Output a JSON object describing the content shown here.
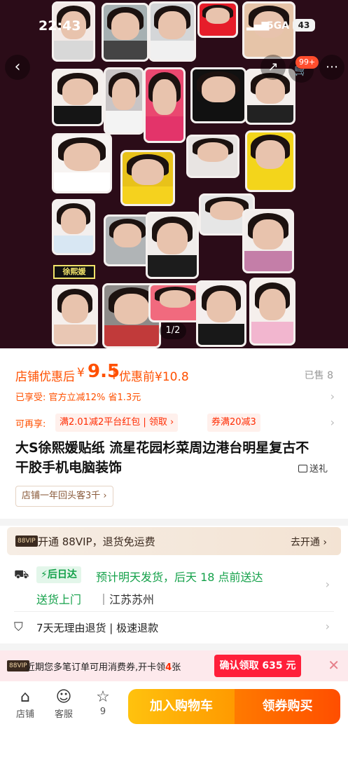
{
  "status_bar": {
    "time": "22:43",
    "network": "5GA",
    "battery": "43"
  },
  "header": {
    "back_icon": "back-arrow-icon",
    "share_icon": "share-icon",
    "cart_icon": "cart-icon",
    "cart_badge": "99+",
    "more_icon": "more-icon"
  },
  "gallery": {
    "pager": "1/2",
    "name_sticker": "徐熙媛"
  },
  "price": {
    "label": "店铺优惠后",
    "currency": "¥",
    "value": "9.5",
    "separator": "|",
    "before_label": "优惠前¥10.8",
    "sold": "已售 8"
  },
  "enjoyed": {
    "text": "已享受: 官方立减12% 省1.3元"
  },
  "more_offers": {
    "label": "可再享:",
    "coupon_platform": "满2.01减2平台红包 | 领取 ›",
    "coupon_store": "券满20减3"
  },
  "product": {
    "title": "大S徐熙媛贴纸 流星花园杉菜周边港台明星复古不干胶手机电脑装饰",
    "gift_label": "送礼",
    "repeat_tag": "店铺一年回头客3千 ›"
  },
  "vip": {
    "badge": "88VIP",
    "text": "开通 88VIP，退货免运费",
    "action": "去开通 ›"
  },
  "shipping": {
    "badge": "后日达",
    "desc": "预计明天发货，后天 18 点前送达",
    "deliver": "送货上门",
    "origin": "江苏苏州"
  },
  "returns": {
    "text": "7天无理由退货 | 极速退款"
  },
  "promo": {
    "badge": "88VIP",
    "text_before": "近期您多笔订单可用消费券,开卡领",
    "text_num": "4",
    "text_after": "张",
    "button": "确认领取 635 元👉",
    "close": "✕"
  },
  "bottom_bar": {
    "tabs": [
      {
        "label": "店铺",
        "icon": "store-icon"
      },
      {
        "label": "客服",
        "icon": "chat-icon"
      },
      {
        "label": "9",
        "icon": "star-icon"
      }
    ],
    "add_cart": "加入购物车",
    "buy": "领券购买"
  },
  "colors": {
    "accent": "#ff5000",
    "green": "#14a14a",
    "hero_bg": "#2b0c18"
  }
}
